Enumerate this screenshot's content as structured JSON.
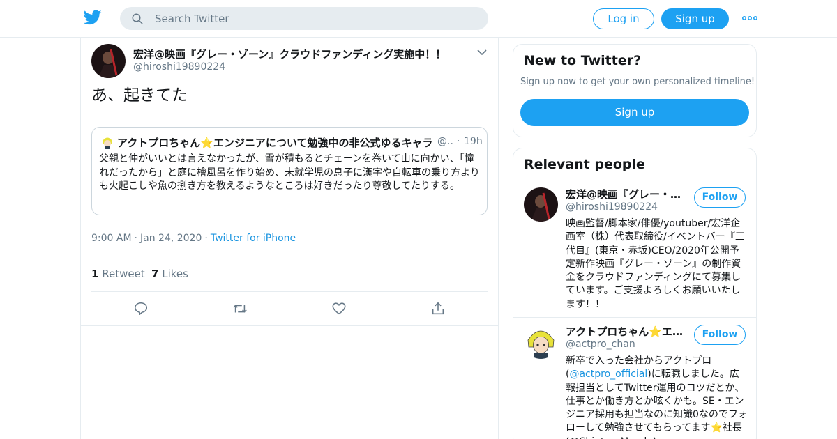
{
  "header": {
    "search_placeholder": "Search Twitter",
    "login_label": "Log in",
    "signup_label": "Sign up"
  },
  "tweet": {
    "author_name": "宏洋@映画『グレー・ゾーン』クラウドファンディング実施中！！",
    "author_handle": "@hiroshi19890224",
    "text": "あ、起きてた",
    "quoted": {
      "author_name": "アクトプロちゃん⭐エンジニアについて勉強中の非公式ゆるキャラ",
      "author_handle": "@..",
      "dot": "·",
      "time": "19h",
      "text": "父親と仲がいいとは言えなかったが、雪が積もるとチェーンを巻いて山に向かい、「憧れだったから」と庭に檜風呂を作り始め、未就学児の息子に漢字や自転車の乗り方よりも火起こしや魚の捌き方を教えるようなところは好きだったり尊敬してたりする。"
    },
    "time": "9:00 AM",
    "date": "Jan 24, 2020",
    "source": "Twitter for iPhone",
    "sep": "·",
    "retweets_count": "1",
    "retweets_label": "Retweet",
    "likes_count": "7",
    "likes_label": "Likes"
  },
  "sidebar": {
    "new_title": "New to Twitter?",
    "new_subtitle": "Sign up now to get your own personalized timeline!",
    "new_button": "Sign up",
    "relevant_title": "Relevant people",
    "people": [
      {
        "name": "宏洋@映画『グレー・ゾーン』クラウドファンディング実施中！！",
        "handle": "@hiroshi19890224",
        "follow_label": "Follow",
        "bio": "映画監督/脚本家/俳優/youtuber/宏洋企画室（株）代表取締役/イベントバー『三代目』(東京・赤坂)CEO/2020年公開予定新作映画『グレー・ゾーン』の制作資金をクラウドファンディングにて募集しています。ご支援よろしくお願いいたします！！"
      },
      {
        "name": "アクトプロちゃん⭐エンジニアについて勉強中の非公式ゆるキャラ",
        "handle": "@actpro_chan",
        "follow_label": "Follow",
        "bio_before": "新卒で入った会社からアクトプロ(",
        "bio_link": "@actpro_official",
        "bio_after": ")に転職しました。広報担当としてTwitter運用のコツだとか、仕事とか働き方とか呟くかも。SE・エンジニア採用も担当なのに知識0なのでフォローして勉強させてもらってます⭐社長(@ShintaroMaeda)"
      }
    ]
  },
  "colors": {
    "brand": "#1da1f2",
    "link": "#1b95e0",
    "secondary_text": "#657786",
    "border": "#e6ecf0"
  },
  "icons": {
    "logo": "twitter-bird-icon",
    "search": "search-icon",
    "more": "more-dots-icon",
    "caret": "chevron-down-icon",
    "reply": "reply-icon",
    "retweet": "retweet-icon",
    "like": "heart-icon",
    "share": "share-icon"
  }
}
